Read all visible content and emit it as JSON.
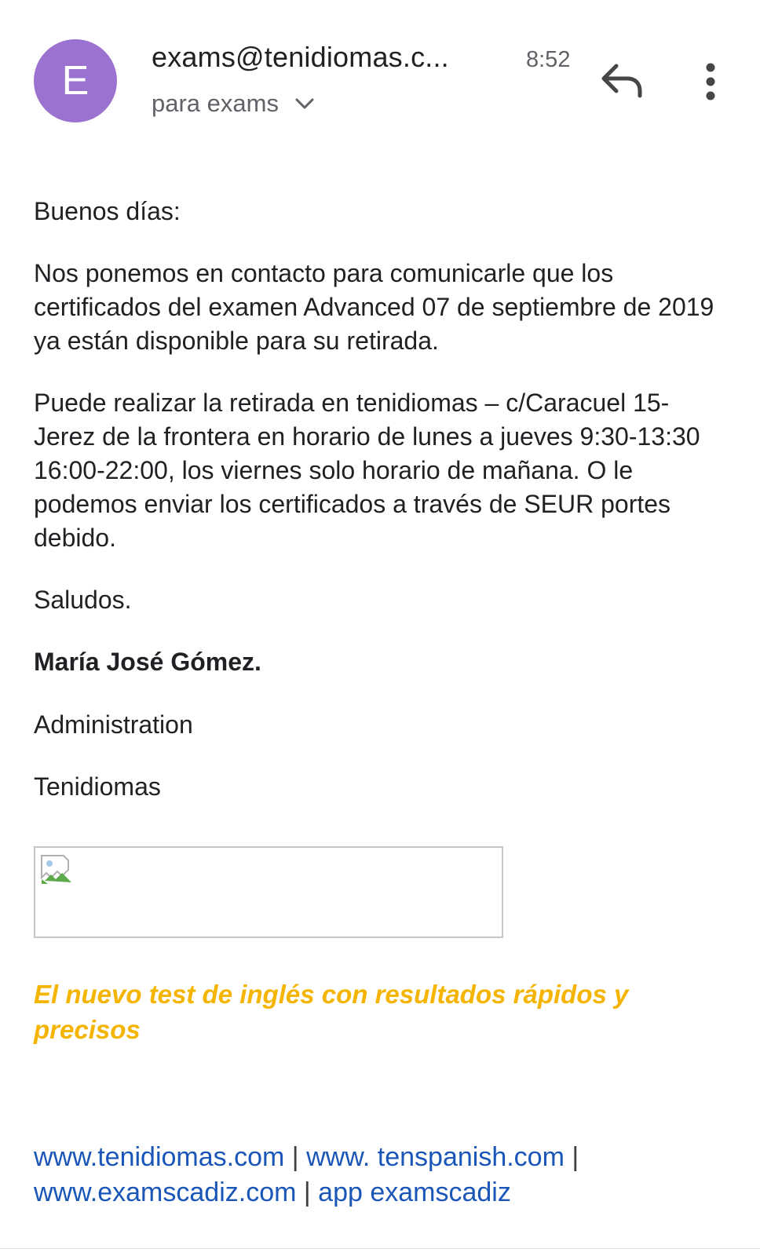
{
  "header": {
    "avatar_letter": "E",
    "avatar_color": "#9b72cf",
    "sender": "exams@tenidiomas.c...",
    "time": "8:52",
    "recipient_label": "para exams",
    "icons": {
      "recipient_toggle": "chevron-down-icon",
      "reply": "reply-icon",
      "more": "more-vertical-icon"
    }
  },
  "body": {
    "greeting": "Buenos días:",
    "paragraph_1": "Nos ponemos en contacto para comunicarle que los certificados del examen Advanced 07 de septiembre de 2019 ya están disponible para su retirada.",
    "paragraph_2": "Puede realizar la retirada en tenidiomas – c/Caracuel 15- Jerez de la frontera en horario de lunes a jueves 9:30-13:30  16:00-22:00, los viernes solo horario de mañana. O le podemos enviar los certificados a través de SEUR portes debido.",
    "closing": "Saludos.",
    "signature_name": "María José Gómez.",
    "signature_role": "Administration",
    "signature_company": "Tenidiomas",
    "promo": "El nuevo test de inglés con resultados rápidos y precisos",
    "promo_color": "#f4b400"
  },
  "links": {
    "items": [
      "www.tenidiomas.com",
      "www. tenspanish.com",
      "www.examscadiz.com",
      "app examscadiz"
    ],
    "separator": "|",
    "link_color": "#1a56b8"
  }
}
